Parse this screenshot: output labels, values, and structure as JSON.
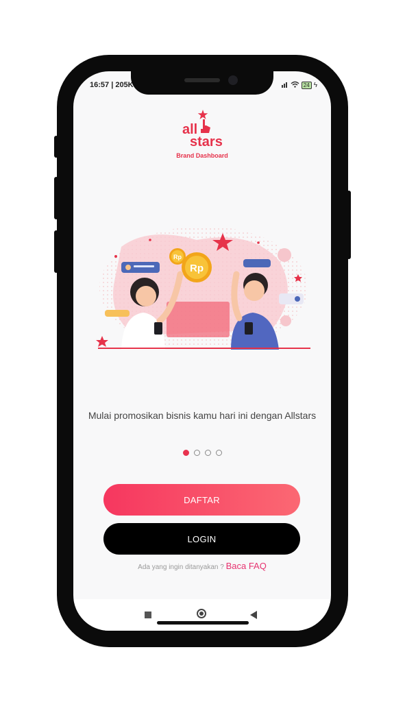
{
  "status": {
    "time": "16:57 | 205K",
    "battery": "24"
  },
  "brand": {
    "logo_line1": "all",
    "logo_line2": "stars",
    "subtitle": "Brand Dashboard"
  },
  "onboarding": {
    "tagline": "Mulai promosikan bisnis kamu hari ini dengan Allstars",
    "coin_label": "Rp",
    "page_count": 4,
    "active_page": 1
  },
  "buttons": {
    "register_label": "DAFTAR",
    "login_label": "LOGIN"
  },
  "faq": {
    "prompt": "Ada yang ingin ditanyakan ? ",
    "link": "Baca FAQ"
  },
  "colors": {
    "brand_red": "#e8334f",
    "gradient_start": "#f6375f",
    "gradient_end": "#fb6873",
    "faq_link": "#e6326f"
  },
  "icons": [
    "wifi-icon",
    "battery-icon",
    "star-icon",
    "coin-icon",
    "chat-bubble-icon",
    "recent-apps-icon",
    "home-icon",
    "back-icon"
  ]
}
